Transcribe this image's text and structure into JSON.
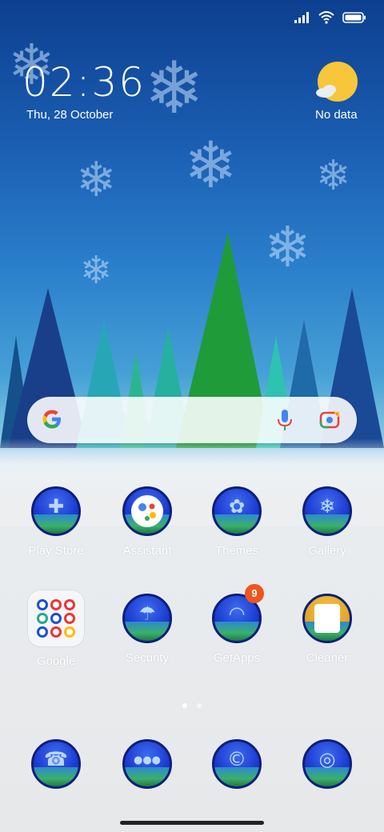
{
  "clock": {
    "time": "02:36",
    "date": "Thu, 28 October"
  },
  "weather": {
    "status": "No data",
    "icon": "sun-cloud-icon"
  },
  "status_bar": {
    "icons": [
      "signal-icon",
      "wifi-icon",
      "battery-icon"
    ]
  },
  "search_bar": {
    "icons": [
      "google-g-icon",
      "mic-icon",
      "lens-icon"
    ]
  },
  "apps_row1": [
    {
      "label": "Play Store",
      "glyph": "✚"
    },
    {
      "label": "Assistant",
      "glyph": ""
    },
    {
      "label": "Themes",
      "glyph": "✿"
    },
    {
      "label": "Gallery",
      "glyph": "❄"
    }
  ],
  "apps_row2": [
    {
      "label": "Google"
    },
    {
      "label": "Security",
      "glyph": "☂"
    },
    {
      "label": "GetApps",
      "glyph": "◠",
      "badge": "9"
    },
    {
      "label": "Cleaner",
      "glyph": ""
    }
  ],
  "dock": [
    {
      "name": "phone-app",
      "glyph": "☎"
    },
    {
      "name": "messages-app",
      "glyph": "●●●"
    },
    {
      "name": "browser-app",
      "glyph": "©"
    },
    {
      "name": "camera-app",
      "glyph": "◎"
    }
  ],
  "page_indicator": {
    "active": 1,
    "count": 2
  },
  "colors": {
    "badge": "#f0541f",
    "icon_ring": "#0c1f7a",
    "label": "#ffffff"
  }
}
